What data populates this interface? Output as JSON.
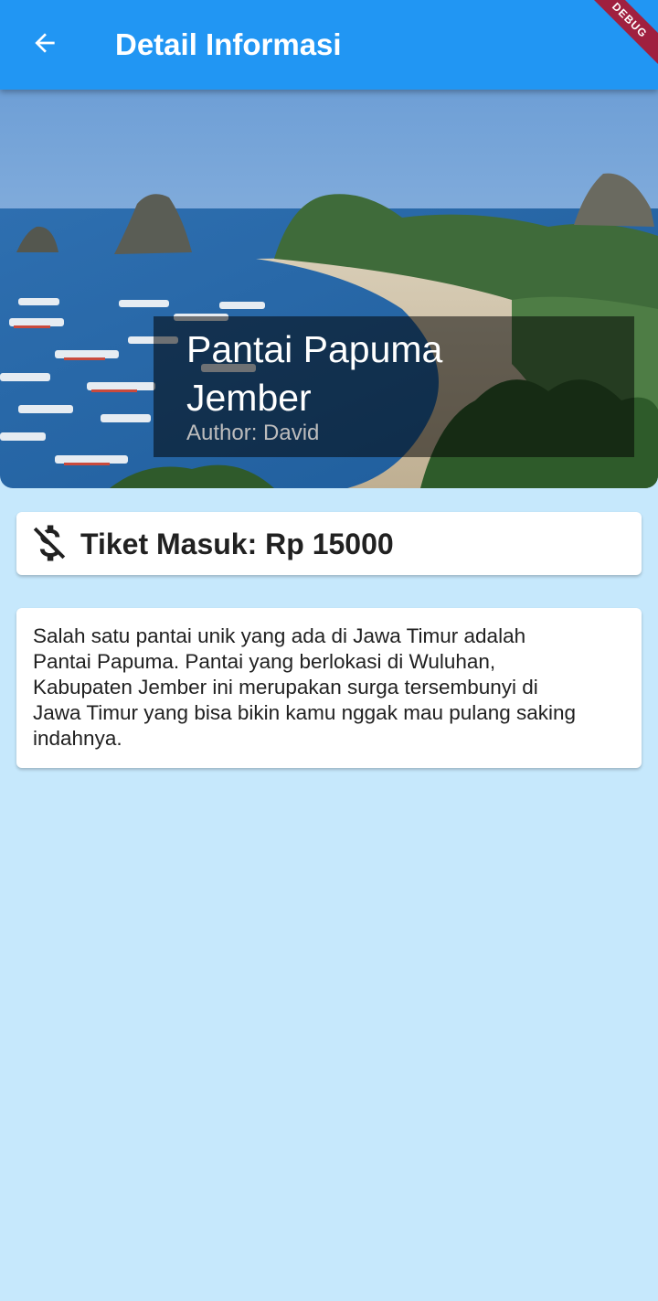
{
  "appbar": {
    "title": "Detail Informasi",
    "back_icon": "arrow-back-icon",
    "debug_banner": "DEBUG",
    "color": "#2196F3"
  },
  "hero": {
    "image_subject": "coastal beach scene with boats and rock islands",
    "title": "Pantai Papuma\nJember",
    "author": "Author: David"
  },
  "price_card": {
    "icon": "money-off-icon",
    "label": "Tiket Masuk: Rp 15000"
  },
  "description": {
    "text": "Salah satu pantai unik yang ada di Jawa Timur adalah\nPantai Papuma. Pantai yang berlokasi di Wuluhan,\nKabupaten Jember ini merupakan surga tersembunyi di\nJawa Timur yang bisa bikin kamu nggak mau pulang saking\nindahnya."
  },
  "colors": {
    "background": "#C6E8FC",
    "card": "#FFFFFF",
    "text": "#212121",
    "author_text": "#BDBDBD"
  }
}
